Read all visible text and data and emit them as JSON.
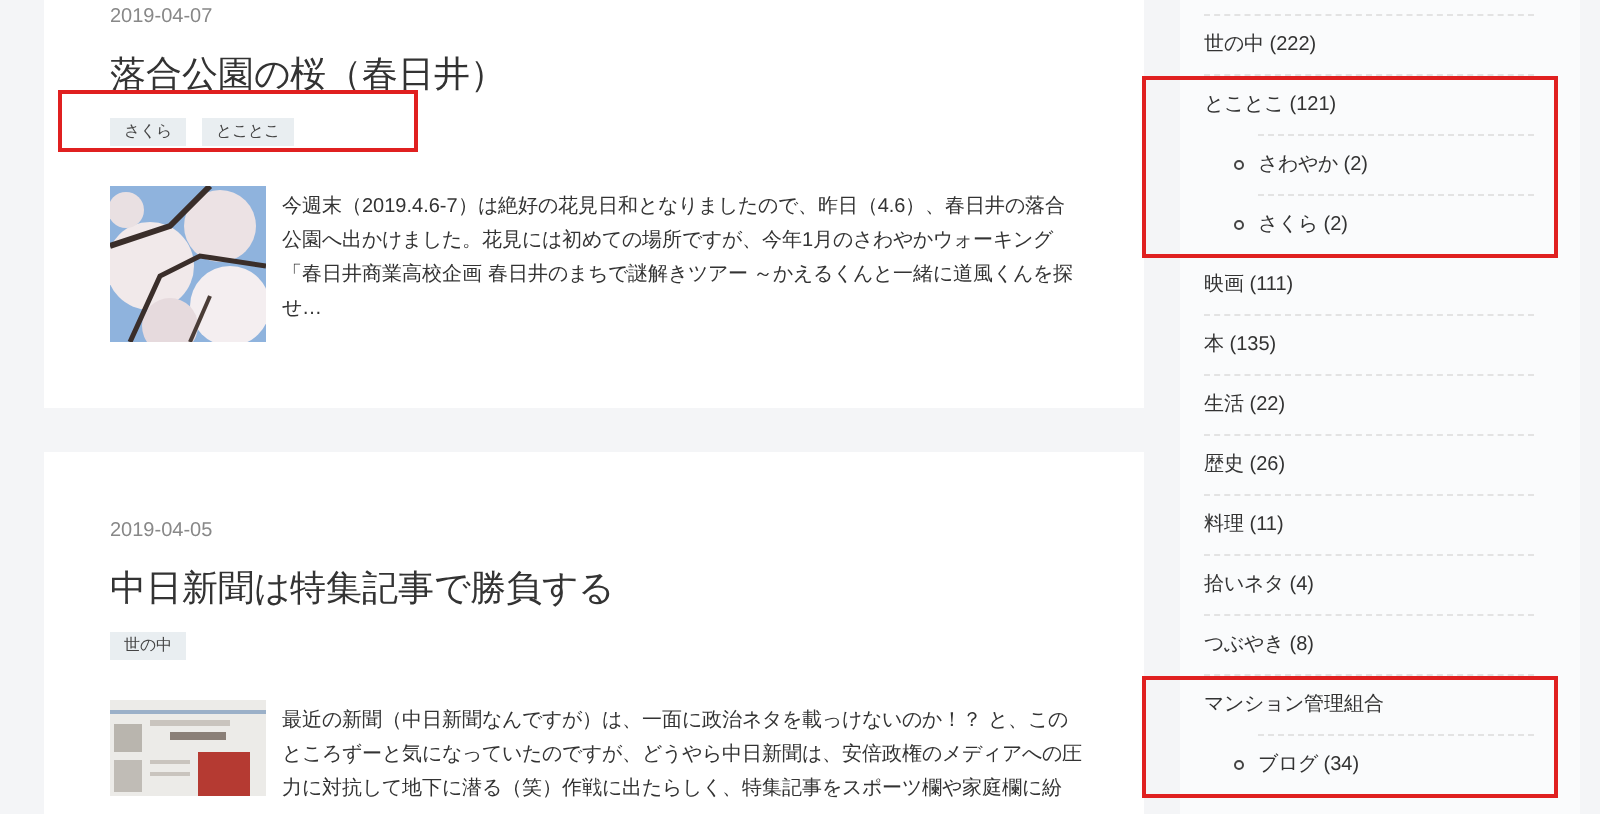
{
  "posts": [
    {
      "date": "2019-04-07",
      "title": "落合公園の桜（春日井）",
      "tags_highlighted": true,
      "tags": [
        "さくら",
        "とことこ"
      ],
      "excerpt": "今週末（2019.4.6-7）は絶好の花見日和となりましたので、昨日（4.6）、春日井の落合公園へ出かけました。花見には初めての場所ですが、今年1月のさわやかウォーキング「春日井商業高校企画 春日井のまちで謎解きツアー ～かえるくんと一緒に道風くんを探せ…"
    },
    {
      "date": "2019-04-05",
      "title": "中日新聞は特集記事で勝負する",
      "tags_highlighted": false,
      "tags": [
        "世の中"
      ],
      "excerpt": "最近の新聞（中日新聞なんですが）は、一面に政治ネタを載っけないのか！？ と、このところずーと気になっていたのですが、どうやら中日新聞は、安倍政権のメディアへの圧力に対抗して地下に潜る（笑）作戦に出たらしく、特集記事をスポーツ欄や家庭欄に紛"
    }
  ],
  "categories": [
    {
      "label": "世の中 (222)",
      "highlighted": false
    },
    {
      "label": "とことこ (121)",
      "highlighted": true,
      "children": [
        {
          "label": "さわやか (2)"
        },
        {
          "label": "さくら (2)"
        }
      ]
    },
    {
      "label": "映画 (111)",
      "highlighted": false
    },
    {
      "label": "本 (135)",
      "highlighted": false
    },
    {
      "label": "生活 (22)",
      "highlighted": false
    },
    {
      "label": "歴史 (26)",
      "highlighted": false
    },
    {
      "label": "料理 (11)",
      "highlighted": false
    },
    {
      "label": "拾いネタ (4)",
      "highlighted": false
    },
    {
      "label": "つぶやき (8)",
      "highlighted": false
    },
    {
      "label": "マンション管理組合",
      "highlighted": true,
      "children": [
        {
          "label": "ブログ (34)"
        }
      ]
    }
  ]
}
